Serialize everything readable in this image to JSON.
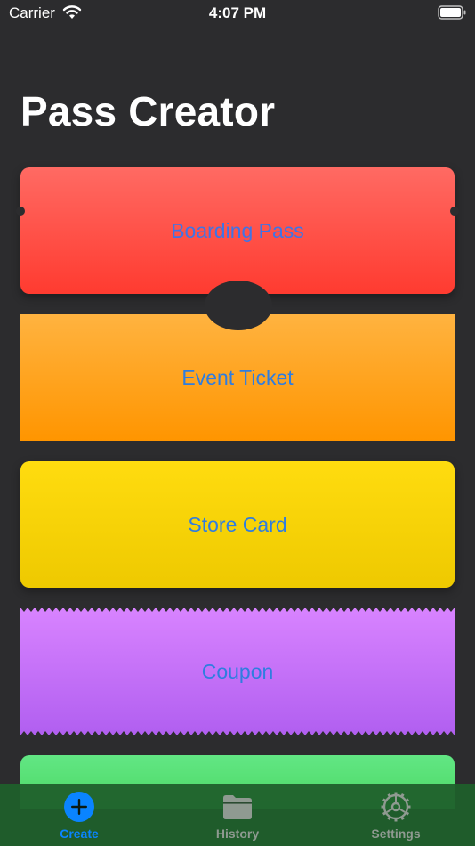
{
  "status_bar": {
    "carrier": "Carrier",
    "time": "4:07 PM"
  },
  "title": "Pass Creator",
  "passes": [
    {
      "label": "Boarding Pass",
      "color": "#ff3b30"
    },
    {
      "label": "Event Ticket",
      "color": "#ff9500"
    },
    {
      "label": "Store Card",
      "color": "#ffcc00"
    },
    {
      "label": "Coupon",
      "color": "#bf5af2"
    },
    {
      "label": "",
      "color": "#4cd964"
    }
  ],
  "tabs": [
    {
      "label": "Create",
      "icon": "plus-circle-icon",
      "active": true
    },
    {
      "label": "History",
      "icon": "folder-icon",
      "active": false
    },
    {
      "label": "Settings",
      "icon": "gear-icon",
      "active": false
    }
  ],
  "colors": {
    "accent": "#0a84ff",
    "background": "#2c2c2e",
    "tab_bar": "#1f602c"
  }
}
